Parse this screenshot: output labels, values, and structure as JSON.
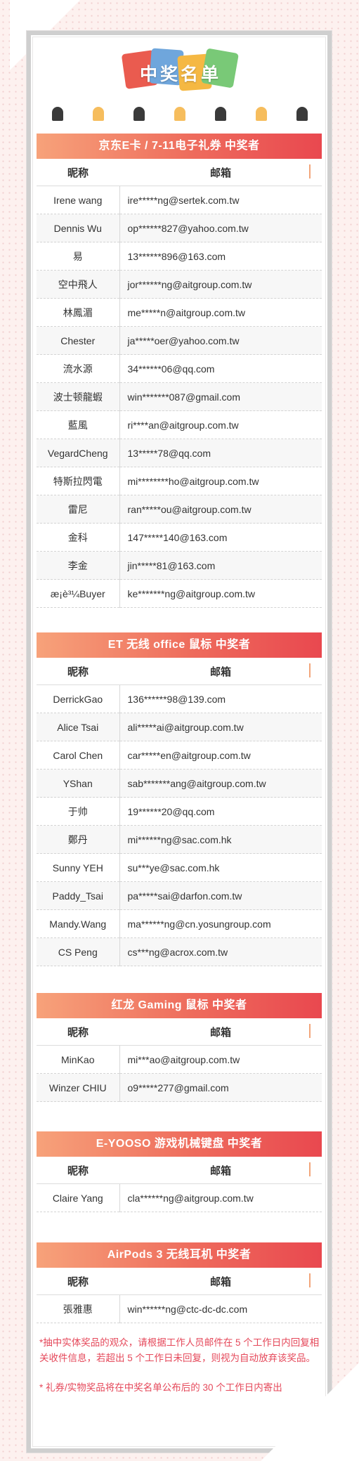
{
  "title": "中奖名单",
  "colors": {
    "accent": "#ea5b4f",
    "header_gradient_start": "#f7a27a",
    "header_gradient_end": "#e9484f",
    "note_text": "#e5485a",
    "hole_dark": "#3a3a3a",
    "hole_gold": "#f6bd5d"
  },
  "columns": {
    "nickname": "昵称",
    "email": "邮箱"
  },
  "sections": [
    {
      "title": "京东E卡 / 7-11电子礼券 中奖者",
      "rows": [
        {
          "name": "Irene wang",
          "email": "ire*****ng@sertek.com.tw"
        },
        {
          "name": "Dennis Wu",
          "email": "op******827@yahoo.com.tw"
        },
        {
          "name": "易",
          "email": "13******896@163.com"
        },
        {
          "name": "空中飛人",
          "email": "jor******ng@aitgroup.com.tw"
        },
        {
          "name": "林鳳湄",
          "email": "me*****n@aitgroup.com.tw"
        },
        {
          "name": "Chester",
          "email": "ja*****oer@yahoo.com.tw"
        },
        {
          "name": "流水源",
          "email": "34******06@qq.com"
        },
        {
          "name": "波士顿龍蝦",
          "email": "win*******087@gmail.com"
        },
        {
          "name": "藍風",
          "email": "ri****an@aitgroup.com.tw"
        },
        {
          "name": "VegardCheng",
          "email": "13*****78@qq.com"
        },
        {
          "name": "特斯拉閃電",
          "email": "mi********ho@aitgroup.com.tw"
        },
        {
          "name": "雷尼",
          "email": "ran*****ou@aitgroup.com.tw"
        },
        {
          "name": "金科",
          "email": "147*****140@163.com"
        },
        {
          "name": "李金",
          "email": "jin*****81@163.com"
        },
        {
          "name": "æ¡è³¼Buyer",
          "email": "ke*******ng@aitgroup.com.tw"
        }
      ]
    },
    {
      "title": "ET 无线 office 鼠标 中奖者",
      "rows": [
        {
          "name": "DerrickGao",
          "email": "136******98@139.com"
        },
        {
          "name": "Alice Tsai",
          "email": "ali*****ai@aitgroup.com.tw"
        },
        {
          "name": "Carol Chen",
          "email": "car*****en@aitgroup.com.tw"
        },
        {
          "name": "YShan",
          "email": "sab*******ang@aitgroup.com.tw"
        },
        {
          "name": "于帅",
          "email": "19******20@qq.com"
        },
        {
          "name": "鄭丹",
          "email": "mi******ng@sac.com.hk"
        },
        {
          "name": "Sunny YEH",
          "email": "su***ye@sac.com.hk"
        },
        {
          "name": "Paddy_Tsai",
          "email": "pa*****sai@darfon.com.tw"
        },
        {
          "name": "Mandy.Wang",
          "email": "ma******ng@cn.yosungroup.com"
        },
        {
          "name": "CS Peng",
          "email": "cs***ng@acrox.com.tw"
        }
      ]
    },
    {
      "title": "红龙 Gaming 鼠标 中奖者",
      "rows": [
        {
          "name": "MinKao",
          "email": "mi***ao@aitgroup.com.tw"
        },
        {
          "name": "Winzer CHIU",
          "email": "o9*****277@gmail.com"
        }
      ]
    },
    {
      "title": "E-YOOSO 游戏机械键盘 中奖者",
      "rows": [
        {
          "name": "Claire Yang",
          "email": "cla******ng@aitgroup.com.tw"
        }
      ]
    },
    {
      "title": "AirPods 3 无线耳机 中奖者",
      "rows": [
        {
          "name": "張雅惠",
          "email": "win******ng@ctc-dc-dc.com"
        }
      ]
    }
  ],
  "notes": [
    "*抽中实体奖品的观众，请根据工作人员邮件在 5 个工作日内回复相关收件信息，若超出 5 个工作日未回复，则视为自动放弃该奖品。",
    "* 礼券/实物奖品将在中奖名单公布后的 30 个工作日内寄出"
  ]
}
